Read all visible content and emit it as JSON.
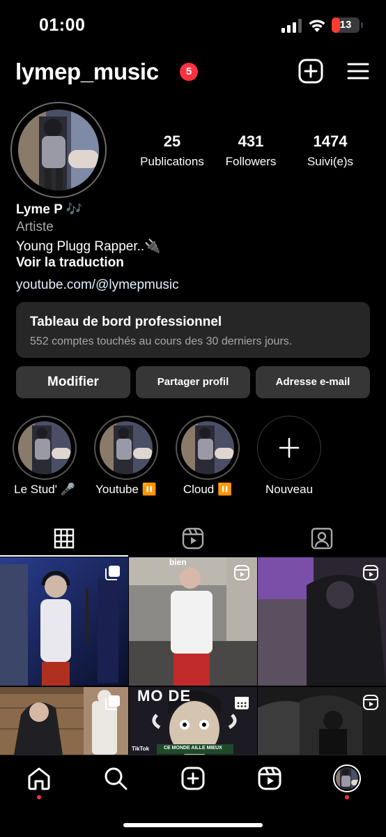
{
  "status_bar": {
    "time": "01:00",
    "battery": "13",
    "battery_level": 0.13
  },
  "header": {
    "username": "lymep_music",
    "notification_count": "5",
    "create_icon": "plus-square-icon",
    "menu_icon": "hamburger-menu-icon"
  },
  "profile": {
    "stats": [
      {
        "value": "25",
        "label": "Publications"
      },
      {
        "value": "431",
        "label": "Followers"
      },
      {
        "value": "1474",
        "label": "Suivi(e)s"
      }
    ],
    "name": "Lyme P 🎶",
    "category": "Artiste",
    "bio": "Young Plugg Rapper..🔌",
    "translate": "Voir la traduction",
    "link": "youtube.com/@lymepmusic"
  },
  "dashboard": {
    "title": "Tableau de bord professionnel",
    "subtitle": "552 comptes touchés au cours des 30 derniers jours."
  },
  "buttons": {
    "edit": "Modifier",
    "share": "Partager profil",
    "email": "Adresse e-mail"
  },
  "highlights": [
    {
      "label": "Le Stud' 🎤"
    },
    {
      "label": "Youtube ⏸️"
    },
    {
      "label": "Cloud ⏸️"
    },
    {
      "label": "Nouveau"
    }
  ],
  "tabs": [
    "grid-icon",
    "reels-icon",
    "tagged-icon"
  ],
  "grid": [
    {
      "icon": "carousel-icon",
      "text": ""
    },
    {
      "icon": "reels-icon",
      "text": "bien"
    },
    {
      "icon": "reels-icon",
      "text": ""
    },
    {
      "icon": "carousel-icon",
      "text": ""
    },
    {
      "icon": "calendar-icon",
      "text": "MO  DE",
      "caption": "CE MONDE AILLE MIEUX",
      "watermark": "TikTok"
    },
    {
      "icon": "reels-icon",
      "text": ""
    }
  ],
  "nav": [
    "home-icon",
    "search-icon",
    "create-icon",
    "reels-icon",
    "profile-avatar"
  ],
  "colors": {
    "background": "#000000",
    "badge": "#ff3040",
    "button": "#363636",
    "card": "#262626",
    "muted": "#a8a8a8"
  }
}
